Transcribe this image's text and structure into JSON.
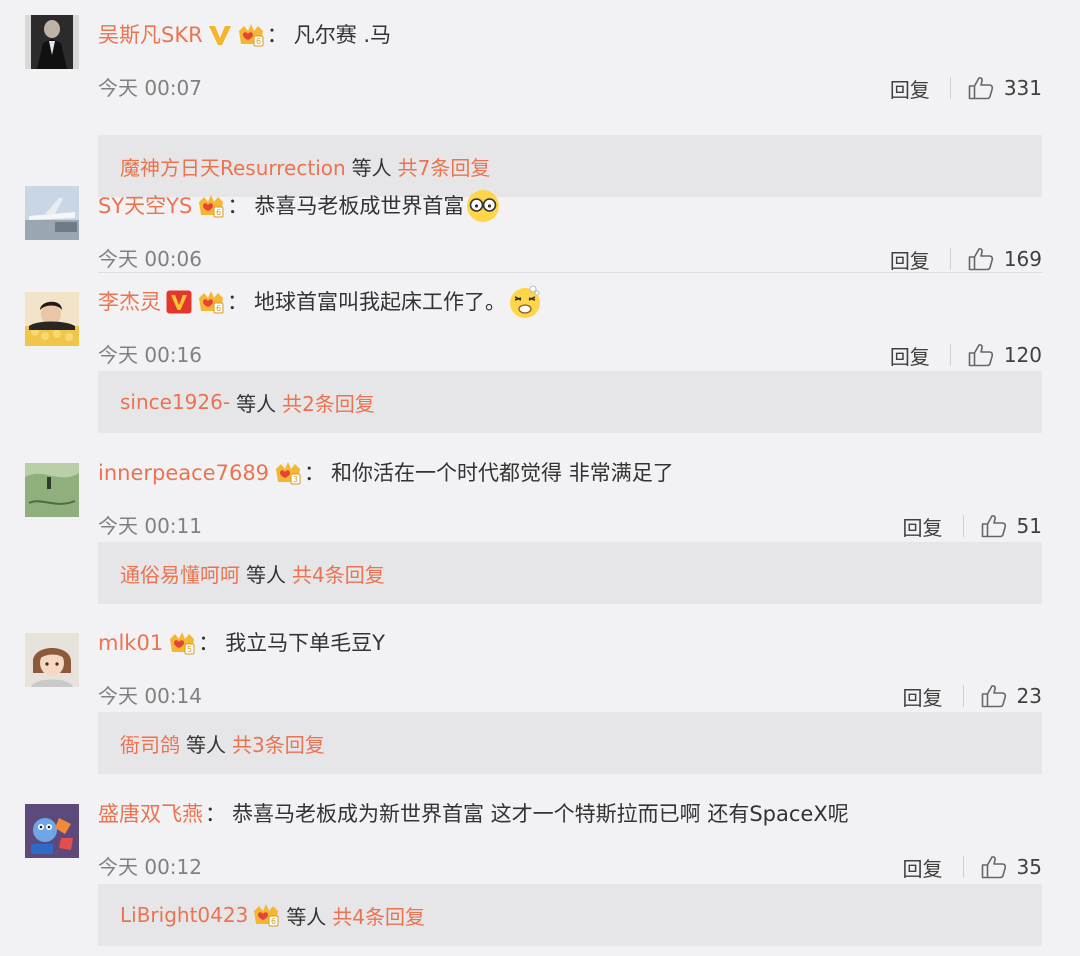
{
  "comments": [
    {
      "username": "吴斯凡SKR",
      "text": "凡尔赛 .马",
      "time": "今天 00:07",
      "reply_label": "回复",
      "likes": "331",
      "badges": [
        "v-gold-icon",
        "vip-crown-icon"
      ],
      "emoji": "",
      "avatar": "avatar-dark-suit",
      "replies": {
        "user": "魔神方日天Resurrection",
        "user_badge": false,
        "mid": "等人",
        "total": "共7条回复"
      }
    },
    {
      "username": "SY天空YS",
      "text": "恭喜马老板成世界首富",
      "time": "今天 00:06",
      "reply_label": "回复",
      "likes": "169",
      "badges": [
        "vip-crown-icon"
      ],
      "emoji": "glasses-emoji",
      "avatar": "avatar-airplane",
      "replies": null
    },
    {
      "username": "李杰灵",
      "text": "地球首富叫我起床工作了。",
      "time": "今天 00:16",
      "reply_label": "回复",
      "likes": "120",
      "badges": [
        "v-red-icon",
        "vip-crown-icon"
      ],
      "emoji": "dizzy-emoji",
      "avatar": "avatar-man-lying",
      "replies": {
        "user": "since1926-",
        "user_badge": false,
        "mid": "等人",
        "total": "共2条回复"
      }
    },
    {
      "username": "innerpeace7689",
      "text": "和你活在一个时代都觉得 非常满足了",
      "time": "今天 00:11",
      "reply_label": "回复",
      "likes": "51",
      "badges": [
        "vip-crown-icon"
      ],
      "emoji": "",
      "avatar": "avatar-green-sketch",
      "replies": {
        "user": "通俗易懂呵呵",
        "user_badge": false,
        "mid": "等人",
        "total": "共4条回复"
      }
    },
    {
      "username": "mlk01",
      "text": "我立马下单毛豆Y",
      "time": "今天 00:14",
      "reply_label": "回复",
      "likes": "23",
      "badges": [
        "vip-crown-icon"
      ],
      "emoji": "",
      "avatar": "avatar-anime-girl",
      "replies": {
        "user": "衙司鸽",
        "user_badge": false,
        "mid": "等人",
        "total": "共3条回复"
      }
    },
    {
      "username": "盛唐双飞燕",
      "text": "恭喜马老板成为新世界首富 这才一个特斯拉而已啊 还有SpaceX呢",
      "time": "今天 00:12",
      "reply_label": "回复",
      "likes": "35",
      "badges": [],
      "emoji": "",
      "avatar": "avatar-cartoon",
      "replies": {
        "user": "LiBright0423",
        "user_badge": true,
        "mid": "等人",
        "total": "共4条回复"
      }
    }
  ],
  "colors": {
    "accent": "#eb7350",
    "background": "#f2f2f5",
    "reply_box": "#e6e6e9",
    "text": "#333333",
    "muted": "#808080"
  }
}
